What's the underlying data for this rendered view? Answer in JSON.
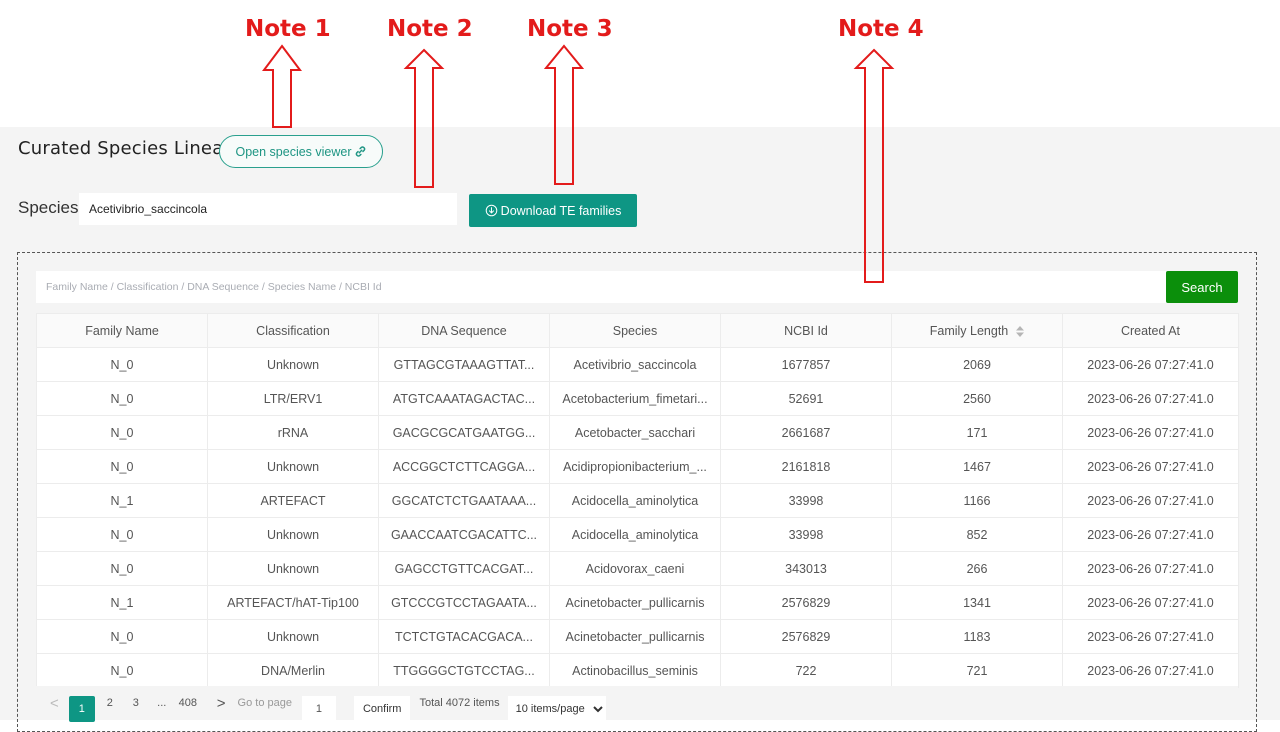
{
  "annotations": {
    "notes": [
      {
        "label": "Note 1"
      },
      {
        "label": "Note 2"
      },
      {
        "label": "Note 3"
      },
      {
        "label": "Note 4"
      }
    ],
    "color": "#e31b1b"
  },
  "header": {
    "title": "Curated Species Lineage",
    "viewer_button": "Open species viewer",
    "viewer_icon": "link-icon"
  },
  "species": {
    "label": "Species",
    "value": "Acetivibrio_saccincola",
    "download_button": "Download TE families",
    "download_icon": "download-circle-icon"
  },
  "search": {
    "placeholder": "Family Name / Classification / DNA Sequence / Species Name / NCBI Id",
    "value": "",
    "button": "Search"
  },
  "table": {
    "columns": [
      "Family Name",
      "Classification",
      "DNA Sequence",
      "Species",
      "NCBI Id",
      "Family Length",
      "Created At"
    ],
    "sortable_column": "Family Length",
    "rows": [
      [
        "N_0",
        "Unknown",
        "GTTAGCGTAAAGTTAT...",
        "Acetivibrio_saccincola",
        "1677857",
        "2069",
        "2023-06-26 07:27:41.0"
      ],
      [
        "N_0",
        "LTR/ERV1",
        "ATGTCAAATAGACTAC...",
        "Acetobacterium_fimetari...",
        "52691",
        "2560",
        "2023-06-26 07:27:41.0"
      ],
      [
        "N_0",
        "rRNA",
        "GACGCGCATGAATGG...",
        "Acetobacter_sacchari",
        "2661687",
        "171",
        "2023-06-26 07:27:41.0"
      ],
      [
        "N_0",
        "Unknown",
        "ACCGGCTCTTCAGGA...",
        "Acidipropionibacterium_...",
        "2161818",
        "1467",
        "2023-06-26 07:27:41.0"
      ],
      [
        "N_1",
        "ARTEFACT",
        "GGCATCTCTGAATAAA...",
        "Acidocella_aminolytica",
        "33998",
        "1166",
        "2023-06-26 07:27:41.0"
      ],
      [
        "N_0",
        "Unknown",
        "GAACCAATCGACATTC...",
        "Acidocella_aminolytica",
        "33998",
        "852",
        "2023-06-26 07:27:41.0"
      ],
      [
        "N_0",
        "Unknown",
        "GAGCCTGTTCACGAT...",
        "Acidovorax_caeni",
        "343013",
        "266",
        "2023-06-26 07:27:41.0"
      ],
      [
        "N_1",
        "ARTEFACT/hAT-Tip100",
        "GTCCCGTCCTAGAATA...",
        "Acinetobacter_pullicarnis",
        "2576829",
        "1341",
        "2023-06-26 07:27:41.0"
      ],
      [
        "N_0",
        "Unknown",
        "TCTCTGTACACGACA...",
        "Acinetobacter_pullicarnis",
        "2576829",
        "1183",
        "2023-06-26 07:27:41.0"
      ],
      [
        "N_0",
        "DNA/Merlin",
        "TTGGGGCTGTCCTAG...",
        "Actinobacillus_seminis",
        "722",
        "721",
        "2023-06-26 07:27:41.0"
      ]
    ]
  },
  "pagination": {
    "prev": "<",
    "next": ">",
    "pages": [
      "1",
      "2",
      "3",
      "...",
      "408"
    ],
    "current_page": "1",
    "goto_label": "Go to page",
    "goto_value": "1",
    "confirm": "Confirm",
    "total": "Total 4072 items",
    "page_size": "10 items/page"
  },
  "colors": {
    "teal": "#0e9684",
    "search_green": "#0b8f0b",
    "note_red": "#e31b1b"
  }
}
